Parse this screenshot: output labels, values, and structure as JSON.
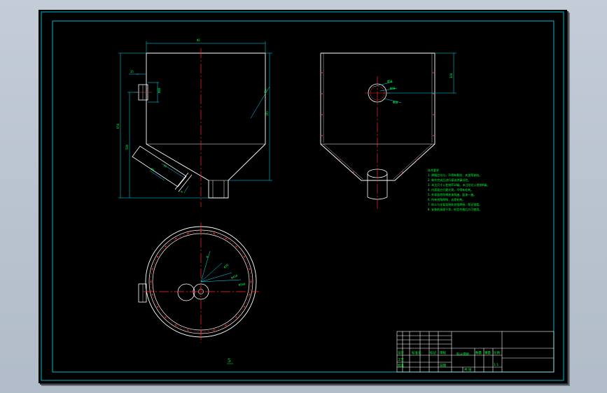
{
  "viewport": {
    "background": "#b9c3cf",
    "sheet": "#000000"
  },
  "colors": {
    "outline": "#ffffff",
    "centerline": "#ff2a2a",
    "dimension": "#00e5ff",
    "text": "#00ff3c",
    "frame": "#00e5ff"
  },
  "views": {
    "front": {
      "dims": {
        "top_width": "Ф1",
        "flange_w": "35",
        "port_dia": "Ф48",
        "height_total": "650",
        "height_lower": "580",
        "right_h": "(8)",
        "slope": "45°",
        "outlet_a": "60",
        "outlet_b": "36",
        "outlet_c": "8"
      }
    },
    "side": {
      "dims": {
        "right_h": "300",
        "hole_a": "Ф50",
        "hole_b": "Ф40",
        "hole_c": "Ф60"
      }
    },
    "plan": {
      "dims": {
        "d1": "Ф",
        "d2": "Ф20",
        "d3": "Ф450",
        "d4": "Ф500"
      },
      "view_label": "5"
    }
  },
  "notes": {
    "heading": "技术要求",
    "lines": [
      "1. 焊缝应均匀，不得有裂纹、夹渣等缺陷。",
      "2. 制作完成后进行煤油渗漏试验。",
      "3. 未注尺寸公差按IT14级，未注形位公差按K级。",
      "4. 内表面应打磨光滑，不得有毛刺。",
      "5. 外表面喷防锈底漆两遍，面漆一遍。",
      "6. 所有锐角倒钝，去除毛刺。",
      "7. 料斗与支架连接处加强焊接，保证强度。",
      "8. 安装前清理干净，检验合格后方可使用。"
    ]
  },
  "title_block": {
    "drawing_name": "料斗焊接",
    "cells": {
      "design": "设计",
      "standard": "标准化",
      "check": "审核",
      "process": "工艺",
      "approve": "批准",
      "date": "日期",
      "scale": "比例",
      "scale_value": "1:1",
      "qty": "数量",
      "weight": "重量",
      "sheet": "共 张",
      "mark": "标记"
    }
  }
}
